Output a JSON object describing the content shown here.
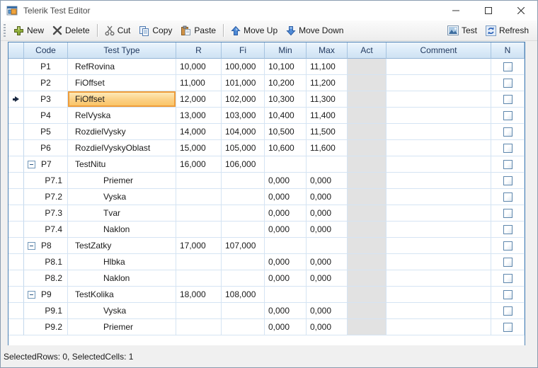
{
  "window": {
    "title": "Telerik Test Editor"
  },
  "toolbar": {
    "new": "New",
    "delete": "Delete",
    "cut": "Cut",
    "copy": "Copy",
    "paste": "Paste",
    "move_up": "Move Up",
    "move_down": "Move Down",
    "test": "Test",
    "refresh": "Refresh"
  },
  "grid": {
    "columns": [
      "Code",
      "Test Type",
      "R",
      "Fi",
      "Min",
      "Max",
      "Act",
      "Comment",
      "N"
    ],
    "rows": [
      {
        "code": "P1",
        "type": "RefRovina",
        "r": "10,000",
        "fi": "100,000",
        "min": "10,100",
        "max": "11,100",
        "comment": "",
        "level": 0,
        "expandable": false,
        "current": false,
        "selected_cell": null,
        "checked": false
      },
      {
        "code": "P2",
        "type": "FiOffset",
        "r": "11,000",
        "fi": "101,000",
        "min": "10,200",
        "max": "11,200",
        "comment": "",
        "level": 0,
        "expandable": false,
        "current": false,
        "selected_cell": null,
        "checked": false
      },
      {
        "code": "P3",
        "type": "FiOffset",
        "r": "12,000",
        "fi": "102,000",
        "min": "10,300",
        "max": "11,300",
        "comment": "",
        "level": 0,
        "expandable": false,
        "current": true,
        "selected_cell": "type",
        "checked": false
      },
      {
        "code": "P4",
        "type": "RelVyska",
        "r": "13,000",
        "fi": "103,000",
        "min": "10,400",
        "max": "11,400",
        "comment": "",
        "level": 0,
        "expandable": false,
        "current": false,
        "selected_cell": null,
        "checked": false
      },
      {
        "code": "P5",
        "type": "RozdielVysky",
        "r": "14,000",
        "fi": "104,000",
        "min": "10,500",
        "max": "11,500",
        "comment": "",
        "level": 0,
        "expandable": false,
        "current": false,
        "selected_cell": null,
        "checked": false
      },
      {
        "code": "P6",
        "type": "RozdielVyskyOblast",
        "r": "15,000",
        "fi": "105,000",
        "min": "10,600",
        "max": "11,600",
        "comment": "",
        "level": 0,
        "expandable": false,
        "current": false,
        "selected_cell": null,
        "checked": false
      },
      {
        "code": "P7",
        "type": "TestNitu",
        "r": "16,000",
        "fi": "106,000",
        "min": "",
        "max": "",
        "comment": "",
        "level": 0,
        "expandable": true,
        "current": false,
        "selected_cell": null,
        "checked": false
      },
      {
        "code": "P7.1",
        "type": "Priemer",
        "r": "",
        "fi": "",
        "min": "0,000",
        "max": "0,000",
        "comment": "",
        "level": 1,
        "expandable": false,
        "current": false,
        "selected_cell": null,
        "checked": false
      },
      {
        "code": "P7.2",
        "type": "Vyska",
        "r": "",
        "fi": "",
        "min": "0,000",
        "max": "0,000",
        "comment": "",
        "level": 1,
        "expandable": false,
        "current": false,
        "selected_cell": null,
        "checked": false
      },
      {
        "code": "P7.3",
        "type": "Tvar",
        "r": "",
        "fi": "",
        "min": "0,000",
        "max": "0,000",
        "comment": "",
        "level": 1,
        "expandable": false,
        "current": false,
        "selected_cell": null,
        "checked": false
      },
      {
        "code": "P7.4",
        "type": "Naklon",
        "r": "",
        "fi": "",
        "min": "0,000",
        "max": "0,000",
        "comment": "",
        "level": 1,
        "expandable": false,
        "current": false,
        "selected_cell": null,
        "checked": false
      },
      {
        "code": "P8",
        "type": "TestZatky",
        "r": "17,000",
        "fi": "107,000",
        "min": "",
        "max": "",
        "comment": "",
        "level": 0,
        "expandable": true,
        "current": false,
        "selected_cell": null,
        "checked": false
      },
      {
        "code": "P8.1",
        "type": "Hlbka",
        "r": "",
        "fi": "",
        "min": "0,000",
        "max": "0,000",
        "comment": "",
        "level": 1,
        "expandable": false,
        "current": false,
        "selected_cell": null,
        "checked": false
      },
      {
        "code": "P8.2",
        "type": "Naklon",
        "r": "",
        "fi": "",
        "min": "0,000",
        "max": "0,000",
        "comment": "",
        "level": 1,
        "expandable": false,
        "current": false,
        "selected_cell": null,
        "checked": false
      },
      {
        "code": "P9",
        "type": "TestKolika",
        "r": "18,000",
        "fi": "108,000",
        "min": "",
        "max": "",
        "comment": "",
        "level": 0,
        "expandable": true,
        "current": false,
        "selected_cell": null,
        "checked": false
      },
      {
        "code": "P9.1",
        "type": "Vyska",
        "r": "",
        "fi": "",
        "min": "0,000",
        "max": "0,000",
        "comment": "",
        "level": 1,
        "expandable": false,
        "current": false,
        "selected_cell": null,
        "checked": false
      },
      {
        "code": "P9.2",
        "type": "Priemer",
        "r": "",
        "fi": "",
        "min": "0,000",
        "max": "0,000",
        "comment": "",
        "level": 1,
        "expandable": false,
        "current": false,
        "selected_cell": null,
        "checked": false
      }
    ]
  },
  "statusbar": {
    "text": "SelectedRows: 0, SelectedCells: 1"
  },
  "colors": {
    "selection_fill": "#fac261",
    "selection_border": "#ef9d3b",
    "grid_border": "#4d82b4",
    "header_text": "#21395f",
    "act_disabled": "#e2e2e2"
  }
}
